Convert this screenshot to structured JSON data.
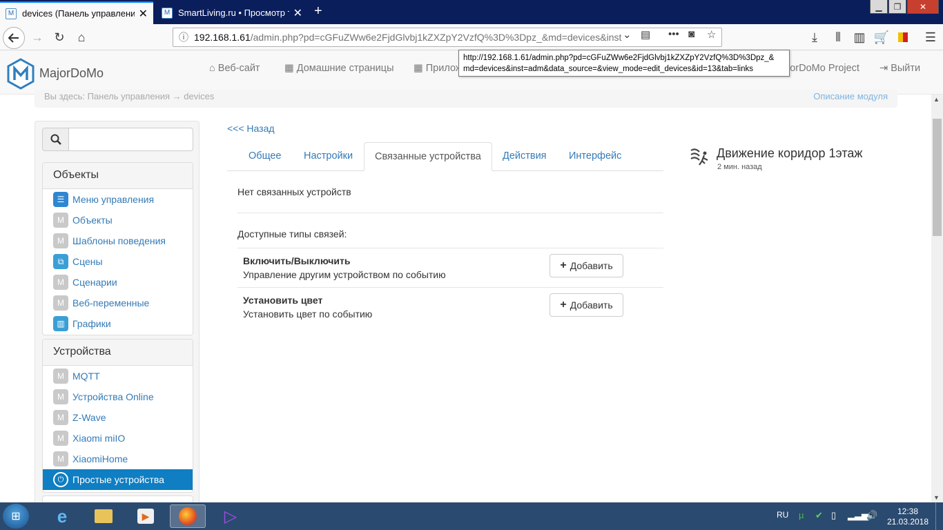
{
  "browser": {
    "tabs": [
      {
        "title": "devices (Панель управления)",
        "active": true
      },
      {
        "title": "SmartLiving.ru • Просмотр те",
        "active": false
      }
    ],
    "url_host": "192.168.1.61",
    "url_path": "/admin.php?pd=cGFuZWw6e2FjdGlvbj1kZXZpY2VzfQ%3D%3Dpz_&md=devices&inst",
    "tooltip_line1": "http://192.168.1.61/admin.php?pd=cGFuZWw6e2FjdGlvbj1kZXZpY2VzfQ%3D%3Dpz_&",
    "tooltip_line2": "md=devices&inst=adm&data_source=&view_mode=edit_devices&id=13&tab=links"
  },
  "header": {
    "brand": "MajorDoMo",
    "nav": [
      "Веб-сайт",
      "Домашние страницы",
      "Прилож",
      "jorDoMo Project",
      "Выйти"
    ],
    "breadcrumb_left": "Вы здесь: Панель управления → devices",
    "breadcrumb_right": "Описание модуля"
  },
  "sidebar": {
    "search_placeholder": "",
    "sections": [
      {
        "title": "Объекты",
        "items": [
          "Меню управления",
          "Объекты",
          "Шаблоны поведения",
          "Сцены",
          "Сценарии",
          "Веб-переменные",
          "Графики"
        ]
      },
      {
        "title": "Устройства",
        "items": [
          "MQTT",
          "Устройства Online",
          "Z-Wave",
          "Xiaomi miIO",
          "XiaomiHome",
          "Простые устройства"
        ]
      }
    ]
  },
  "main": {
    "back_link": "<<< Назад",
    "tabs": [
      "Общее",
      "Настройки",
      "Связанные устройства",
      "Действия",
      "Интерфейс"
    ],
    "active_tab": "Связанные устройства",
    "no_links": "Нет связанных устройств",
    "available_label": "Доступные типы связей:",
    "link_types": [
      {
        "title": "Включить/Выключить",
        "desc": "Управление другим устройством по событию"
      },
      {
        "title": "Установить цвет",
        "desc": "Установить цвет по событию"
      }
    ],
    "add_label": "Добавить"
  },
  "device": {
    "title": "Движение коридор 1этаж",
    "time": "2 мин. назад"
  },
  "taskbar": {
    "lang": "RU",
    "time": "12:38",
    "date": "21.03.2018"
  },
  "colors": {
    "link": "#337ab7",
    "active_item": "#0f7ec2",
    "titlebar": "#0b1e5c",
    "taskbar": "#2b4a6f"
  }
}
